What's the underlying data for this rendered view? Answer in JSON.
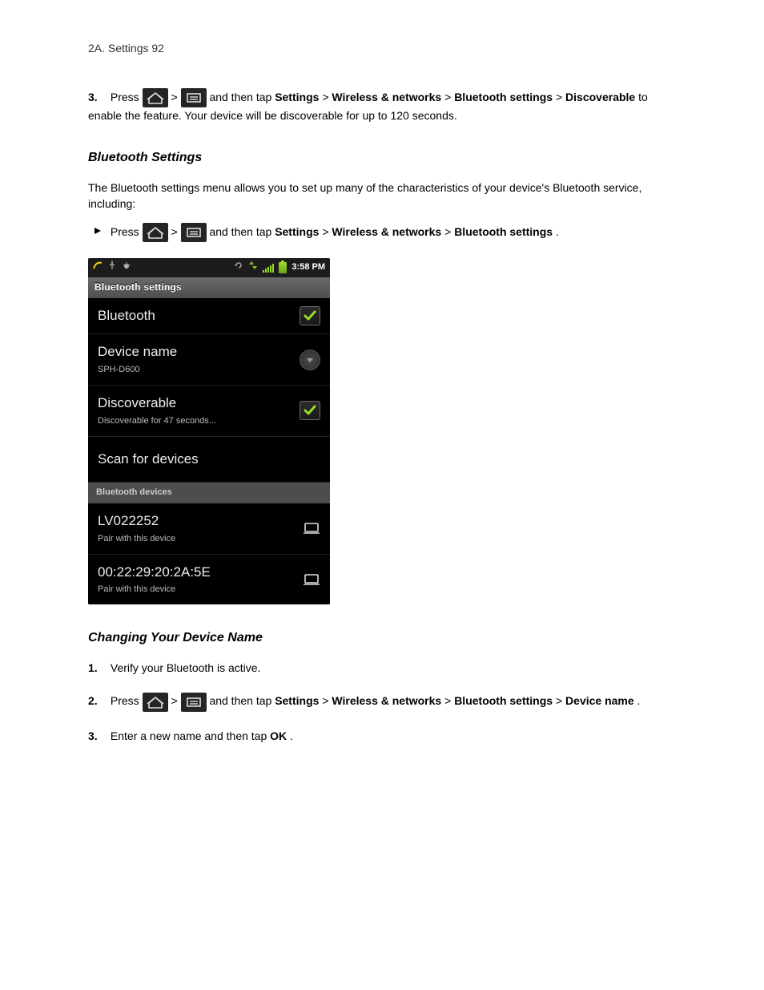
{
  "page": {
    "number_line": "2A.  Settings    92"
  },
  "step3": {
    "num": "3.",
    "text_before_home": "Press ",
    "text_between": " > ",
    "text_after_menu": "  and then tap ",
    "bold1": "Settings",
    "sep1": " > ",
    "bold2": "Wireless & networks",
    "sep2": " > ",
    "bold3": "Bluetooth settings",
    "sep3": " > ",
    "bold4": "Discoverable",
    "tail": " to enable the feature. Your device will be discoverable for up to 120 seconds."
  },
  "heading1": "Bluetooth Settings",
  "lead1": "The Bluetooth settings menu allows you to set up many of the characteristics of your device's Bluetooth service, including:",
  "bl_arrow": {
    "text_before": "Press ",
    "text_between": " > ",
    "text_after_menu": "  and then tap ",
    "bold1": "Settings",
    "sep1": " > ",
    "bold2": "Wireless & networks",
    "sep2": " > ",
    "bold3": "Bluetooth settings",
    "tail": "."
  },
  "screenshot": {
    "statusbar": {
      "time": "3:58 PM"
    },
    "panel_title": "Bluetooth settings",
    "rows": {
      "bluetooth": {
        "title": "Bluetooth"
      },
      "device_name": {
        "title": "Device name",
        "sub": "SPH-D600"
      },
      "discoverable": {
        "title": "Discoverable",
        "sub": "Discoverable for 47 seconds..."
      },
      "scan": {
        "title": "Scan for devices"
      }
    },
    "devices_header": "Bluetooth devices",
    "devices": [
      {
        "title": "LV022252",
        "sub": "Pair with this device"
      },
      {
        "title": "00:22:29:20:2A:5E",
        "sub": "Pair with this device"
      }
    ]
  },
  "heading2": "Changing Your Device Name",
  "step1b": {
    "num": "1.",
    "text": "Verify your Bluetooth is active."
  },
  "step2b": {
    "num": "2.",
    "text_before": "Press ",
    "text_between": " > ",
    "text_after_menu": "  and then tap ",
    "bold1": "Settings",
    "sep1": " > ",
    "bold2": "Wireless & networks",
    "sep2": " > ",
    "bold3": "Bluetooth settings",
    "sep3": " > ",
    "bold4": "Device name",
    "tail": "."
  },
  "step3b": {
    "num": "3.",
    "text_before": "Enter a new name and then tap ",
    "bold1": "OK",
    "tail": "."
  }
}
